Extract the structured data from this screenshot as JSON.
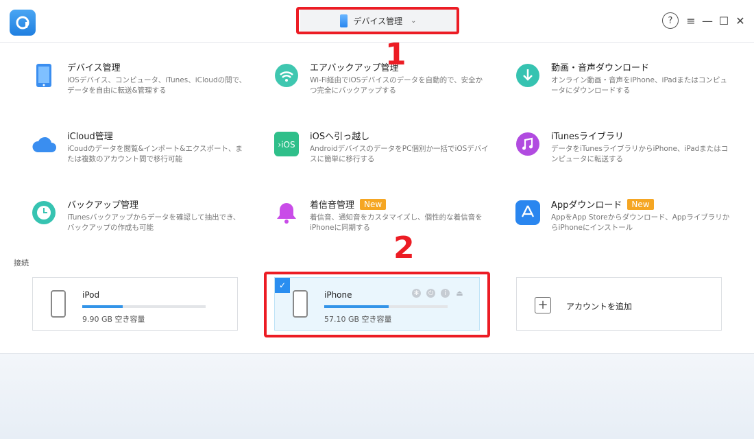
{
  "header": {
    "device_selector_label": "デバイス管理",
    "help": "?",
    "menu": "≡",
    "minimize": "—",
    "maximize": "☐",
    "close": "✕"
  },
  "annotations": [
    "1",
    "2"
  ],
  "features": [
    {
      "title": "デバイス管理",
      "desc": "iOSデバイス、コンピュータ、iTunes、iCloudの間で、データを自由に転送&管理する",
      "icon": "phone-icon",
      "color": "#3a8ef0"
    },
    {
      "title": "エアバックアップ管理",
      "desc": "Wi-Fi経由でiOSデバイスのデータを自動的で、安全かつ完全にバックアップする",
      "icon": "wifi-icon",
      "color": "#3fc7b0"
    },
    {
      "title": "動画・音声ダウンロード",
      "desc": "オンライン動画・音声をiPhone、iPadまたはコンピュータにダウンロードする",
      "icon": "download-icon",
      "color": "#36c3b1"
    },
    {
      "title": "iCloud管理",
      "desc": "iCoudのデータを閲覧&インポート&エクスポート、または複数のアカウント間で移行可能",
      "icon": "cloud-icon",
      "color": "#3a8ef0"
    },
    {
      "title": "iOSへ引っ越し",
      "desc": "AndroidデバイスのデータをPC個別か一括でiOSデバイスに簡単に移行する",
      "icon": "ios-transfer-icon",
      "color": "#2fbf8a"
    },
    {
      "title": "iTunesライブラリ",
      "desc": "データをiTunesライブラリからiPhone、iPadまたはコンピュータに転送する",
      "icon": "music-icon",
      "color": "#b14be0"
    },
    {
      "title": "バックアップ管理",
      "desc": "iTunesバックアップからデータを確認して抽出でき、バックアップの作成も可能",
      "icon": "clock-icon",
      "color": "#36c3b1"
    },
    {
      "title": "着信音管理",
      "desc": "着信音、通知音をカスタマイズし、個性的な着信音をiPhoneに同期する",
      "icon": "bell-icon",
      "color": "#c94ce8",
      "badge": "New"
    },
    {
      "title": "Appダウンロード",
      "desc": "AppをApp Storeからダウンロード、AppライブラリからiPhoneにインストール",
      "icon": "appstore-icon",
      "color": "#2a86ef",
      "badge": "New"
    }
  ],
  "connection": {
    "label": "接続",
    "devices": [
      {
        "name": "iPod",
        "free": "9.90 GB 空き容量",
        "usage": 0.33,
        "selected": false
      },
      {
        "name": "iPhone",
        "free": "57.10 GB 空き容量",
        "usage": 0.52,
        "selected": true
      }
    ],
    "add_account_label": "アカウントを追加"
  }
}
